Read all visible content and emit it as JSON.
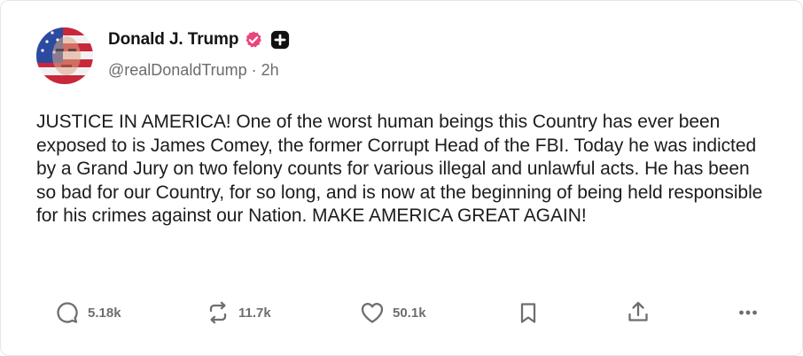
{
  "post": {
    "author": {
      "display_name": "Donald J. Trump",
      "handle": "@realDonaldTrump",
      "separator": "·",
      "time_ago": "2h",
      "verified_icon": "verified-badge-icon",
      "affiliate_icon": "plus-square-icon"
    },
    "body": "JUSTICE IN AMERICA! One of the worst human beings this Country has ever been exposed to is James Comey, the former Corrupt Head of the FBI. Today he was indicted by a Grand Jury on two felony counts for various illegal and unlawful acts. He has been so bad for our Country, for so long, and is now at the beginning of being held responsible for his crimes against our Nation. MAKE AMERICA GREAT AGAIN!",
    "actions": {
      "replies": "5.18k",
      "reposts": "11.7k",
      "likes": "50.1k"
    }
  },
  "colors": {
    "verified": "#e8467c",
    "muted": "#6e6e6e",
    "text": "#1c1c1c"
  }
}
